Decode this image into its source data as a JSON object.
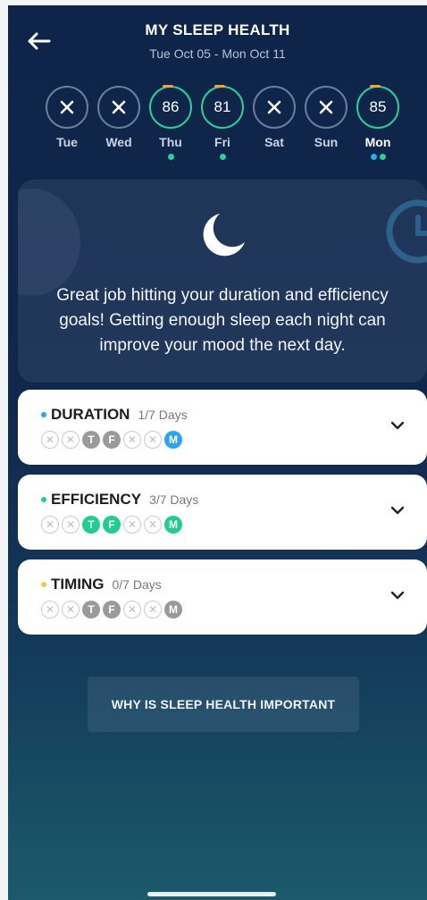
{
  "header": {
    "title": "MY SLEEP HEALTH",
    "date_range": "Tue Oct 05 - Mon Oct 11"
  },
  "days": [
    {
      "label": "Tue",
      "score": null,
      "dots": []
    },
    {
      "label": "Wed",
      "score": null,
      "dots": []
    },
    {
      "label": "Thu",
      "score": "86",
      "dots": [
        "green"
      ]
    },
    {
      "label": "Fri",
      "score": "81",
      "dots": [
        "green"
      ]
    },
    {
      "label": "Sat",
      "score": null,
      "dots": []
    },
    {
      "label": "Sun",
      "score": null,
      "dots": []
    },
    {
      "label": "Mon",
      "score": "85",
      "dots": [
        "blue",
        "green"
      ],
      "current": true
    }
  ],
  "insight": {
    "text": "Great job hitting your duration and efficiency goals! Getting enough sleep each night can improve your mood the next day."
  },
  "goals": [
    {
      "name": "DURATION",
      "count": "1/7 Days",
      "color": "#2aa4ee",
      "days": [
        {
          "letter": "",
          "state": "missed"
        },
        {
          "letter": "",
          "state": "missed"
        },
        {
          "letter": "T",
          "state": "grey"
        },
        {
          "letter": "F",
          "state": "grey"
        },
        {
          "letter": "",
          "state": "missed"
        },
        {
          "letter": "",
          "state": "missed"
        },
        {
          "letter": "M",
          "state": "blue"
        }
      ]
    },
    {
      "name": "EFFICIENCY",
      "count": "3/7 Days",
      "color": "#1fce8f",
      "days": [
        {
          "letter": "",
          "state": "missed"
        },
        {
          "letter": "",
          "state": "missed"
        },
        {
          "letter": "T",
          "state": "green"
        },
        {
          "letter": "F",
          "state": "green"
        },
        {
          "letter": "",
          "state": "missed"
        },
        {
          "letter": "",
          "state": "missed"
        },
        {
          "letter": "M",
          "state": "green"
        }
      ]
    },
    {
      "name": "TIMING",
      "count": "0/7 Days",
      "color": "#f1c842",
      "days": [
        {
          "letter": "",
          "state": "missed"
        },
        {
          "letter": "",
          "state": "missed"
        },
        {
          "letter": "T",
          "state": "grey"
        },
        {
          "letter": "F",
          "state": "grey"
        },
        {
          "letter": "",
          "state": "missed"
        },
        {
          "letter": "",
          "state": "missed"
        },
        {
          "letter": "M",
          "state": "grey"
        }
      ]
    }
  ],
  "why_button": {
    "label": "WHY IS SLEEP HEALTH IMPORTANT"
  },
  "colors": {
    "score_ring": "#2ecf97",
    "score_accent": "#f3a333",
    "background_top": "#0e2449",
    "background_bottom": "#1b5a6a"
  },
  "icons": {
    "back": "arrow-left-icon",
    "insight": "moon-icon",
    "missed_day": "x-icon",
    "expand": "chevron-down-icon"
  }
}
